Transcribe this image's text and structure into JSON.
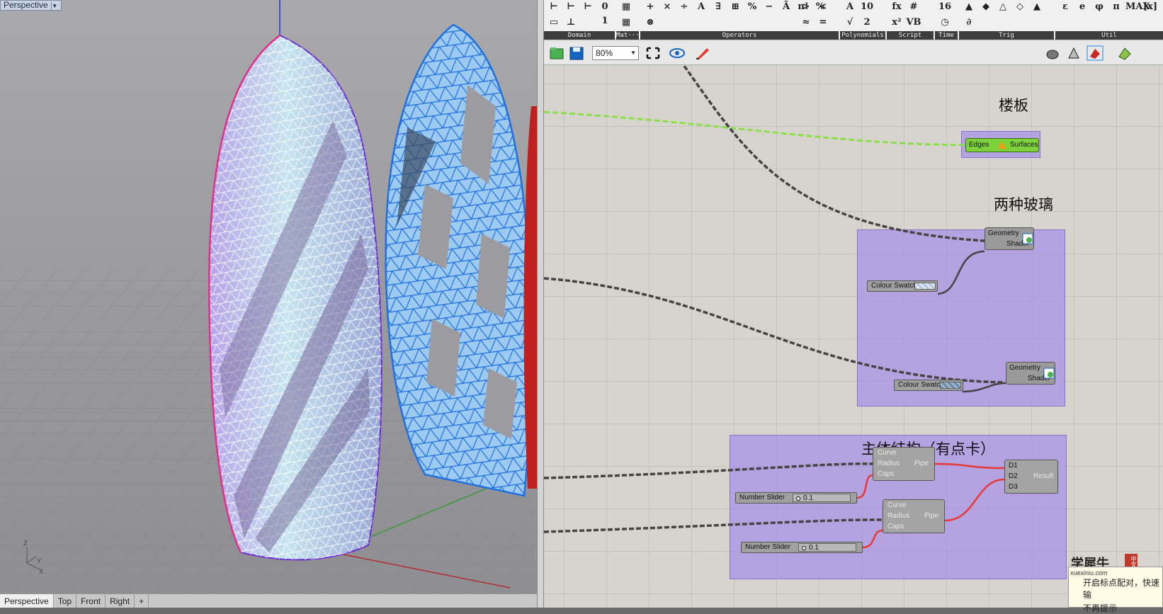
{
  "viewport": {
    "label": "Perspective",
    "tabs": [
      "Perspective",
      "Top",
      "Front",
      "Right",
      "+"
    ],
    "axis_z": "Z",
    "axis_x": "X",
    "axis_y": "Y"
  },
  "ribbon": {
    "groups": [
      {
        "label": "Domain",
        "icons": [
          "⊢",
          "⊢",
          "⊢",
          "0 1",
          "▭",
          "⊥"
        ]
      },
      {
        "label": "Mat···",
        "icons": [
          "▦",
          "▦"
        ]
      },
      {
        "label": "Operators",
        "icons": [
          "+",
          "×",
          "÷",
          "A",
          "∃",
          "⊞",
          "%",
          "−",
          "Ã",
          "n!",
          "%",
          "⊗"
        ]
      },
      {
        "label": "",
        "icons": [
          ">",
          "<",
          "≈",
          "=",
          "−",
          "<"
        ]
      },
      {
        "label": "Polynomials",
        "icons": [
          "A",
          "√",
          "10",
          "2"
        ]
      },
      {
        "label": "Script",
        "icons": [
          "fx",
          "x²",
          "#",
          "VB"
        ]
      },
      {
        "label": "Time",
        "icons": [
          "16",
          "◷"
        ]
      },
      {
        "label": "Trig",
        "icons": [
          "▲",
          "◆",
          "△",
          "◇",
          "▲",
          "∂"
        ]
      },
      {
        "label": "Util",
        "icons": [
          "ε",
          "e",
          "φ",
          "π",
          "MAX",
          "[x]"
        ]
      }
    ]
  },
  "toolbar": {
    "zoom": "80%"
  },
  "canvas": {
    "group1_title": "楼板",
    "group2_title": "两种玻璃",
    "group3_title": "主体结构（有点卡）",
    "edges_surfaces": {
      "in": "Edges",
      "out": "Surfaces"
    },
    "shader1": {
      "in": "Geometry",
      "out": "Shader"
    },
    "shader2": {
      "in": "Geometry",
      "out": "Shader"
    },
    "swatch1": "Colour Swatch",
    "swatch2": "Colour Swatch",
    "pipe1": {
      "in1": "Curve",
      "in2": "Radius",
      "in3": "Caps",
      "out": "Pipe"
    },
    "pipe2": {
      "in1": "Curve",
      "in2": "Radius",
      "in3": "Caps",
      "out": "Pipe"
    },
    "merge": {
      "in1": "D1",
      "in2": "D2",
      "in3": "D3",
      "out": "Result"
    },
    "slider1": {
      "label": "Number Slider",
      "value": "0.1"
    },
    "slider2": {
      "label": "Number Slider",
      "value": "0.1"
    }
  },
  "watermark": {
    "brand": "学犀牛",
    "url": "xuexiniu.com",
    "badge": "中文网"
  },
  "popup": {
    "line1": "开启标点配对，快速输",
    "line2": "不再提示"
  }
}
